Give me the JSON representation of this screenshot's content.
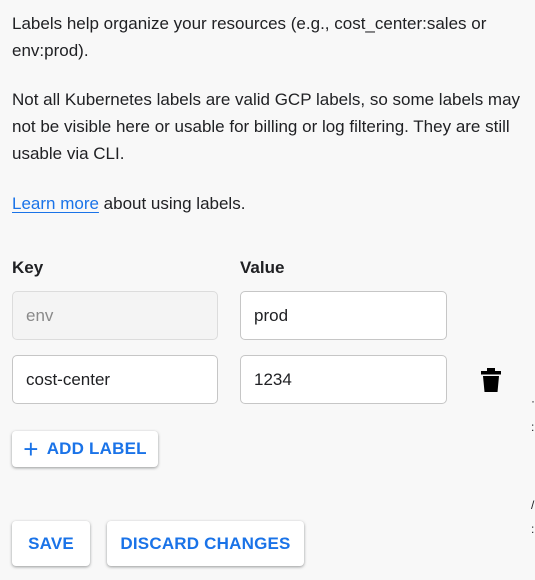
{
  "intro": {
    "text": "Labels help organize your resources (e.g., cost_center:sales or env:prod).",
    "warning": "Not all Kubernetes labels are valid GCP labels, so some labels may not be visible here or usable for billing or log filtering. They are still usable via CLI.",
    "learn_more_link": "Learn more",
    "learn_more_suffix": " about using labels."
  },
  "columns": {
    "key": "Key",
    "value": "Value"
  },
  "labels": [
    {
      "key": "env",
      "value": "prod",
      "key_editable": false,
      "deletable": false
    },
    {
      "key": "cost-center",
      "value": "1234",
      "key_editable": true,
      "deletable": true
    }
  ],
  "actions": {
    "add_label": "ADD LABEL",
    "save": "SAVE",
    "discard": "DISCARD CHANGES"
  },
  "icons": {
    "add": "plus-icon",
    "delete": "trash-icon"
  },
  "colors": {
    "accent": "#1a73e8",
    "background": "#f8f8f8"
  }
}
